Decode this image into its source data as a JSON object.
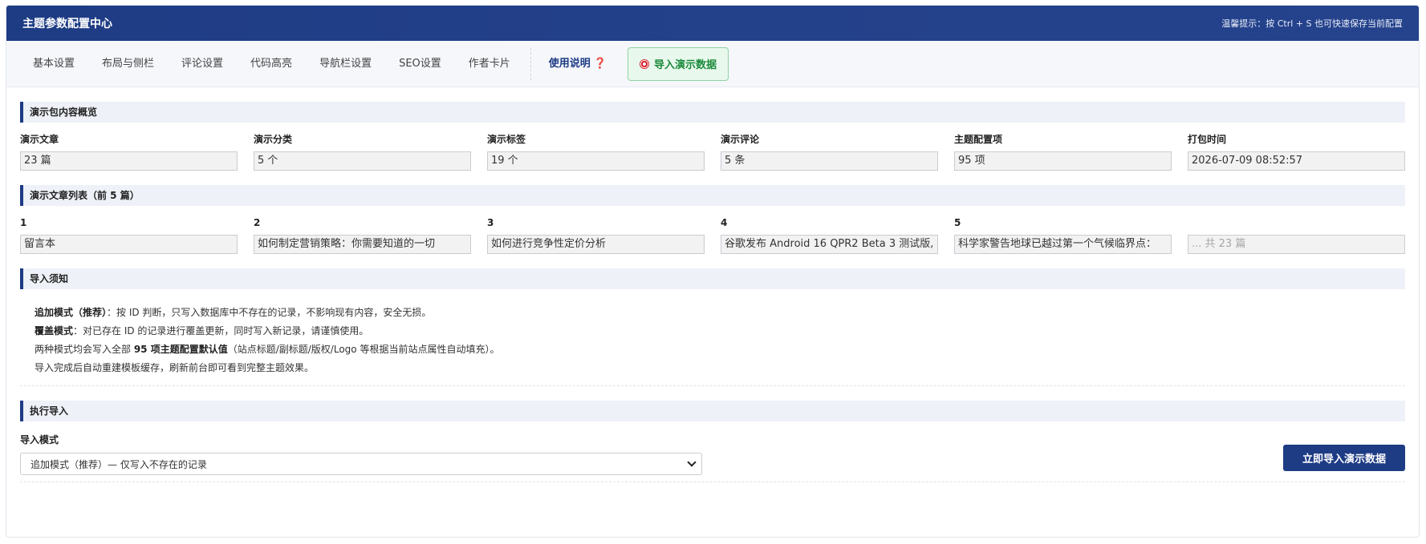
{
  "header": {
    "title": "主题参数配置中心",
    "tip": "温馨提示：按 Ctrl + S 也可快速保存当前配置"
  },
  "tabs": [
    {
      "label": "基本设置"
    },
    {
      "label": "布局与侧栏"
    },
    {
      "label": "评论设置"
    },
    {
      "label": "代码高亮"
    },
    {
      "label": "导航栏设置"
    },
    {
      "label": "SEO设置"
    },
    {
      "label": "作者卡片"
    }
  ],
  "help_tab": {
    "label": "使用说明",
    "mark": "❓"
  },
  "import_tab": {
    "label": "导入演示数据",
    "icon": "dart-target-icon"
  },
  "overview": {
    "title": "演示包内容概览",
    "items": [
      {
        "label": "演示文章",
        "value": "23 篇"
      },
      {
        "label": "演示分类",
        "value": "5 个"
      },
      {
        "label": "演示标签",
        "value": "19 个"
      },
      {
        "label": "演示评论",
        "value": "5 条"
      },
      {
        "label": "主题配置项",
        "value": "95 项"
      },
      {
        "label": "打包时间",
        "value": "2026-07-09 08:52:57"
      }
    ]
  },
  "article_list": {
    "title": "演示文章列表（前 5 篇）",
    "items": [
      {
        "label": "1",
        "value": "留言本"
      },
      {
        "label": "2",
        "value": "如何制定营销策略：你需要知道的一切"
      },
      {
        "label": "3",
        "value": "如何进行竞争性定价分析"
      },
      {
        "label": "4",
        "value": "谷歌发布 Android 16 QPR2 Beta 3 测试版,"
      },
      {
        "label": "5",
        "value": "科学家警告地球已越过第一个气候临界点："
      }
    ],
    "more_placeholder": "... 共 23 篇"
  },
  "notice": {
    "title": "导入须知",
    "line1_bold": "追加模式（推荐）",
    "line1_text": "：按 ID 判断，只写入数据库中不存在的记录，不影响现有内容，安全无损。",
    "line2_bold": "覆盖模式",
    "line2_text": "：对已存在 ID 的记录进行覆盖更新，同时写入新记录，请谨慎使用。",
    "line3_pre": "两种模式均会写入全部 ",
    "line3_bold": "95 项主题配置默认值",
    "line3_post": "（站点标题/副标题/版权/Logo 等根据当前站点属性自动填充）。",
    "line4": "导入完成后自动重建模板缓存，刷新前台即可看到完整主题效果。"
  },
  "execute": {
    "title": "执行导入",
    "mode_label": "导入模式",
    "mode_value": "追加模式（推荐）— 仅写入不存在的记录",
    "button_label": "立即导入演示数据"
  },
  "colors": {
    "brand": "#1e3c84",
    "import_green": "#1a8a3a",
    "help_red": "#d8232a"
  }
}
